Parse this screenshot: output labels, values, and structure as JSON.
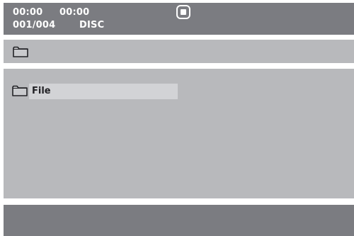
{
  "status": {
    "elapsed_time": "00:00",
    "remaining_time": "00:00",
    "track_counter": "001/004",
    "source": "DISC",
    "playback_icon": "stop-icon"
  },
  "path_bar": {
    "icon": "folder-icon"
  },
  "file_list": {
    "items": [
      {
        "icon": "folder-icon",
        "label": "File",
        "selected": true
      }
    ]
  },
  "colors": {
    "bar_dark": "#7b7c81",
    "panel": "#b8b9bc",
    "selection": "#d2d3d6"
  }
}
